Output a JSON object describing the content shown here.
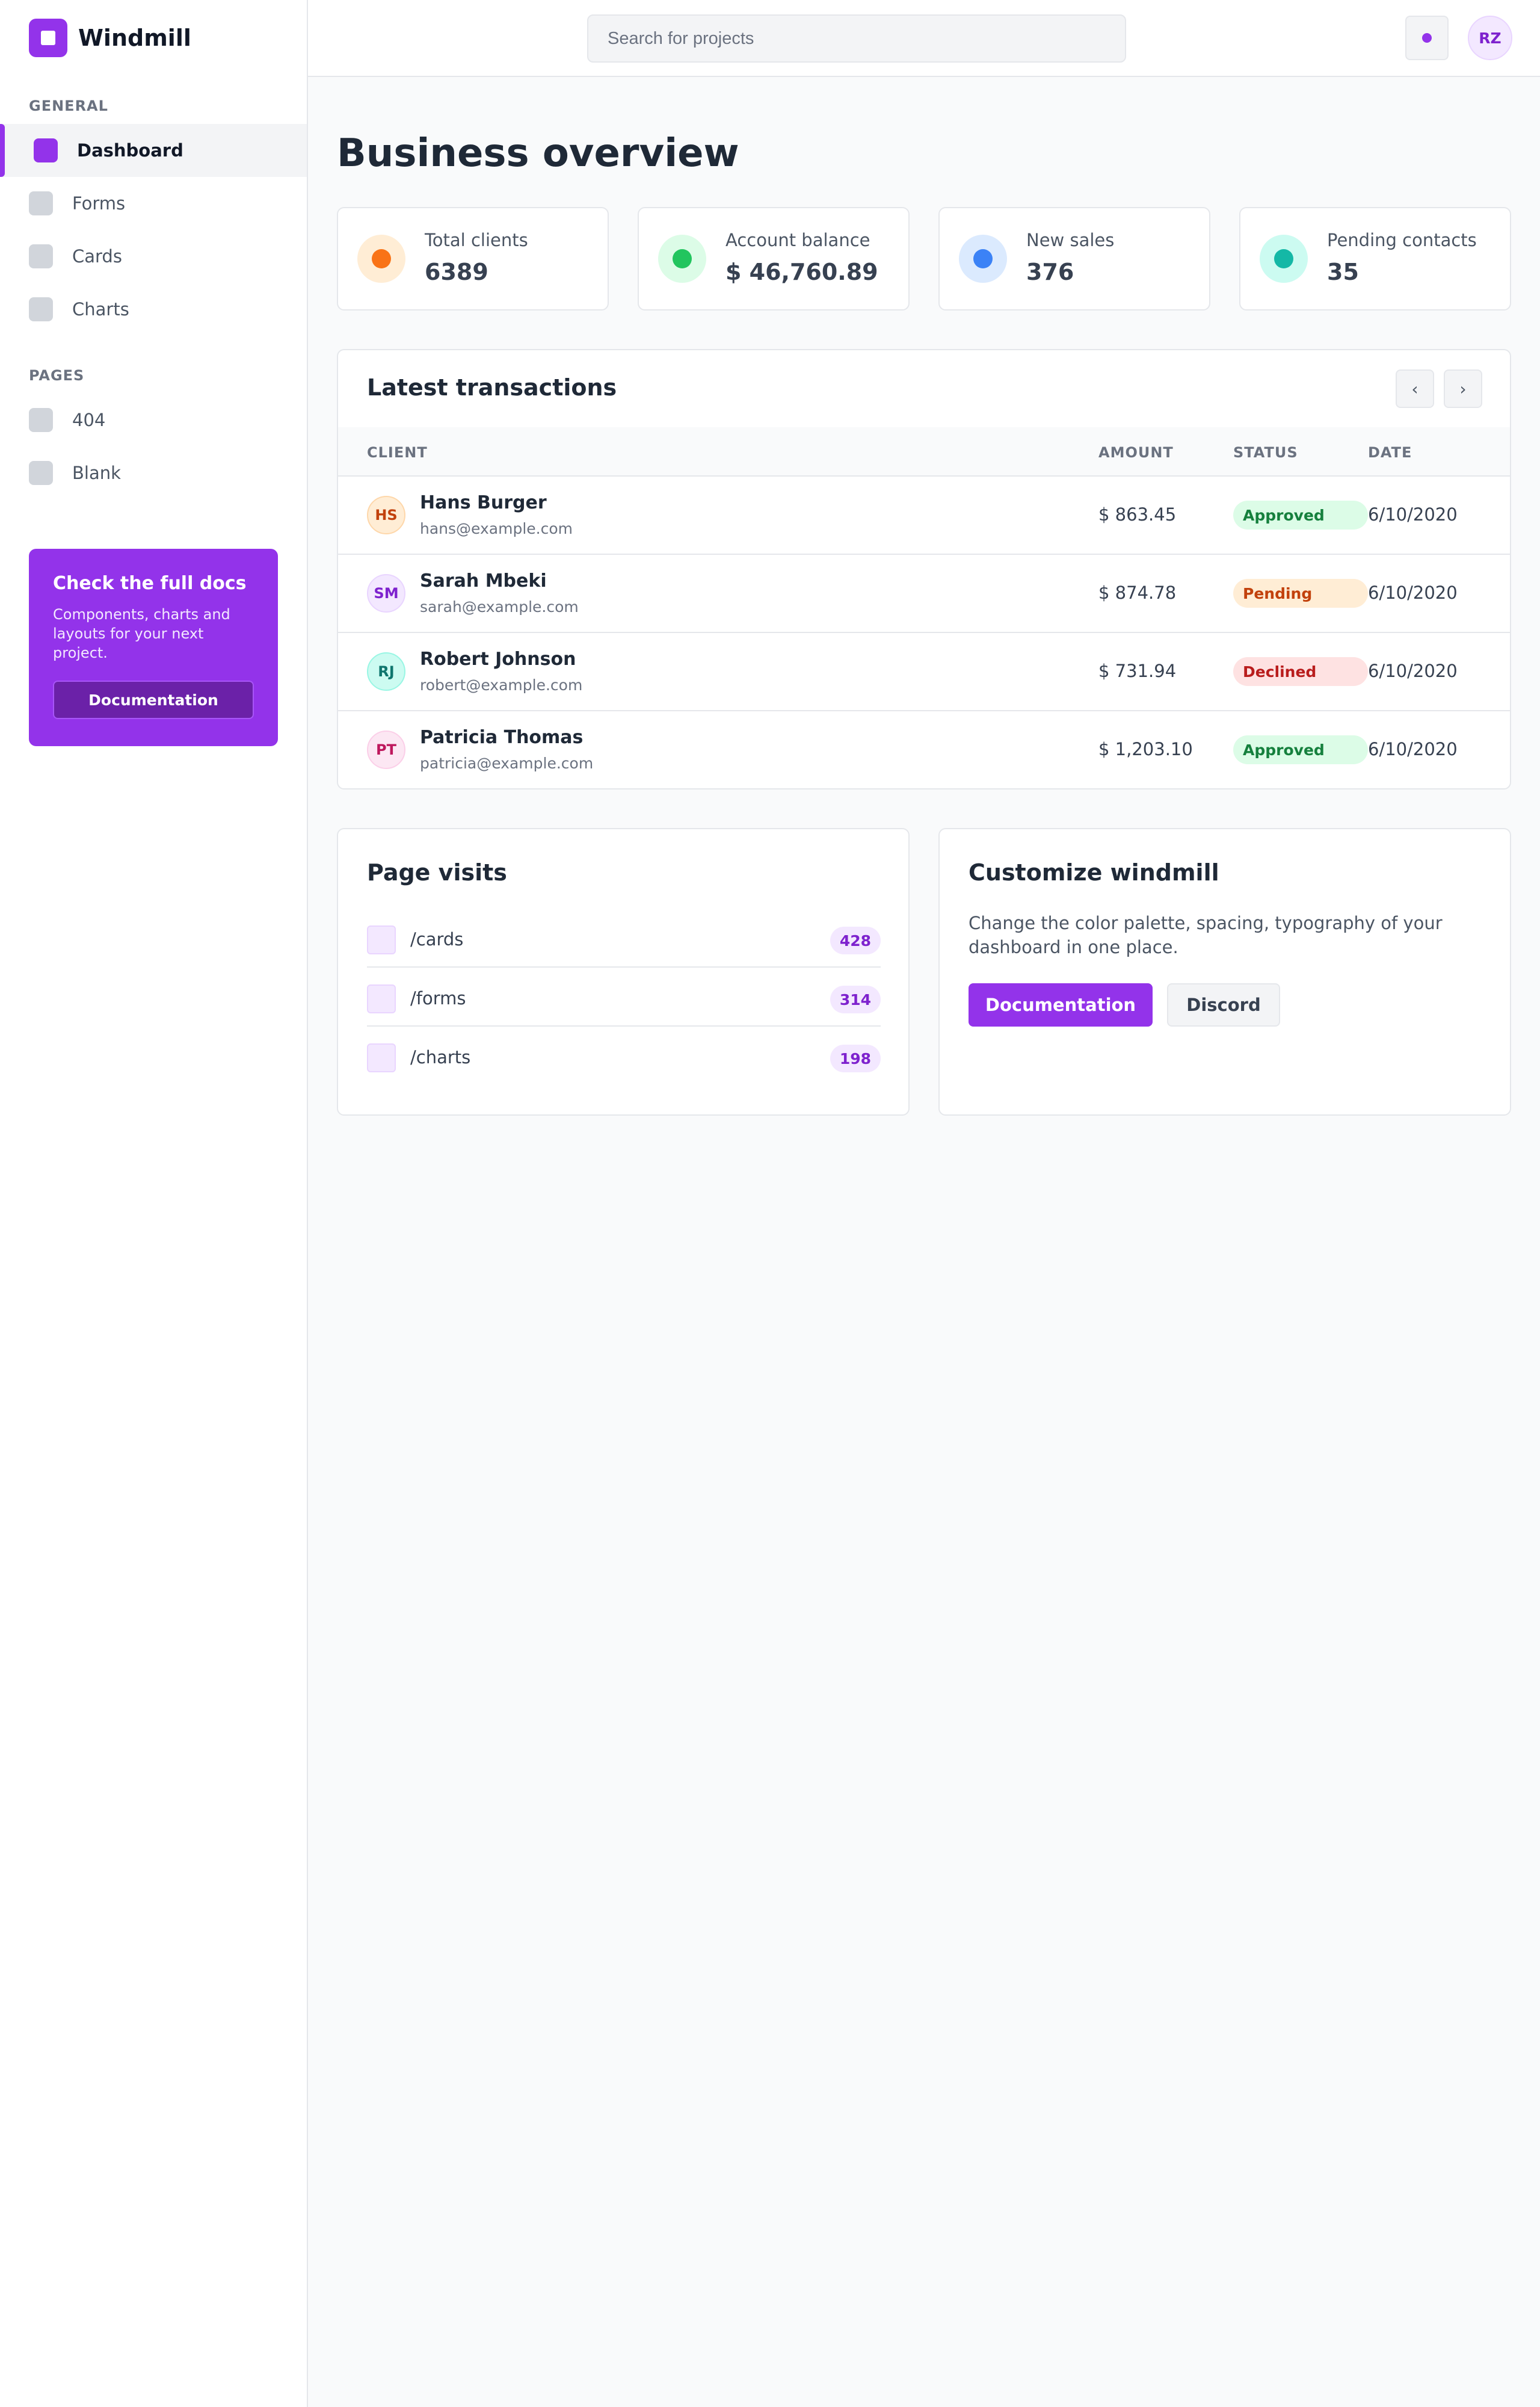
{
  "brand": {
    "name": "Windmill",
    "logo_icon": "windmill-logo-icon"
  },
  "sidebar": {
    "general_label": "GENERAL",
    "pages_label": "PAGES",
    "general_items": [
      {
        "label": "Dashboard",
        "icon": "dashboard-icon",
        "active": true
      },
      {
        "label": "Forms",
        "icon": "forms-icon",
        "active": false
      },
      {
        "label": "Cards",
        "icon": "cards-icon",
        "active": false
      },
      {
        "label": "Charts",
        "icon": "charts-icon",
        "active": false
      }
    ],
    "page_items": [
      {
        "label": "404",
        "icon": "404-icon"
      },
      {
        "label": "Blank",
        "icon": "blank-icon"
      }
    ],
    "docs_card": {
      "title": "Check the full docs",
      "text": "Components, charts and layouts for your next project.",
      "button": "Documentation"
    }
  },
  "header": {
    "search_placeholder": "Search for projects",
    "notification_icon": "notification-dot-icon",
    "user_initials": "RZ"
  },
  "main": {
    "title": "Business overview",
    "stats": [
      {
        "label": "Total clients",
        "value": "6389",
        "color": "#f97316",
        "bg": "#ffedd5"
      },
      {
        "label": "Account balance",
        "value": "$ 46,760.89",
        "color": "#22c55e",
        "bg": "#dcfce7"
      },
      {
        "label": "New sales",
        "value": "376",
        "color": "#3b82f6",
        "bg": "#dbeafe"
      },
      {
        "label": "Pending contacts",
        "value": "35",
        "color": "#14b8a6",
        "bg": "#ccfbf1"
      }
    ],
    "transactions": {
      "title": "Latest transactions",
      "prev": "‹",
      "next": "›",
      "columns": [
        "CLIENT",
        "AMOUNT",
        "STATUS",
        "DATE"
      ],
      "rows": [
        {
          "initials": "HS",
          "name": "Hans Burger",
          "email": "hans@example.com",
          "amount": "$ 863.45",
          "status": "Approved",
          "date": "6/10/2020"
        },
        {
          "initials": "SM",
          "name": "Sarah Mbeki",
          "email": "sarah@example.com",
          "amount": "$ 874.78",
          "status": "Pending",
          "date": "6/10/2020"
        },
        {
          "initials": "RJ",
          "name": "Robert Johnson",
          "email": "robert@example.com",
          "amount": "$ 731.94",
          "status": "Declined",
          "date": "6/10/2020"
        },
        {
          "initials": "PT",
          "name": "Patricia Thomas",
          "email": "patricia@example.com",
          "amount": "$ 1,203.10",
          "status": "Approved",
          "date": "6/10/2020"
        }
      ]
    },
    "page_visits": {
      "title": "Page visits",
      "items": [
        {
          "path": "/cards",
          "count": "428"
        },
        {
          "path": "/forms",
          "count": "314"
        },
        {
          "path": "/charts",
          "count": "198"
        }
      ]
    },
    "customize": {
      "title": "Customize windmill",
      "text": "Change the color palette, spacing, typography of your dashboard in one place.",
      "primary_button": "Documentation",
      "secondary_button": "Discord"
    }
  },
  "colors": {
    "accent": "#9333ea",
    "approved_bg": "#dcfce7",
    "approved_fg": "#15803d",
    "pending_bg": "#ffedd5",
    "pending_fg": "#c2410c",
    "declined_bg": "#fee2e2",
    "declined_fg": "#b91c1c"
  }
}
